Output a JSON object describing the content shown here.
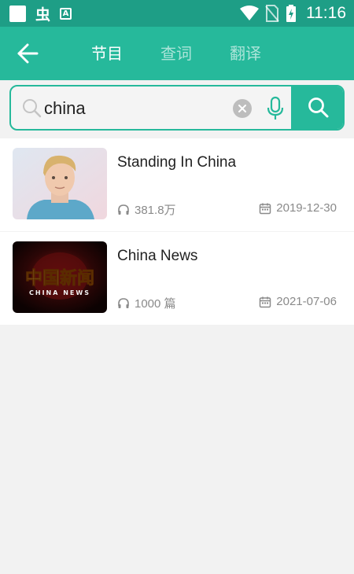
{
  "status_bar": {
    "time": "11:16",
    "left_icons": [
      "square-notification-icon",
      "bug-icon",
      "a-box-icon"
    ],
    "right_icons": [
      "wifi-icon",
      "no-sim-icon",
      "battery-charging-icon"
    ]
  },
  "app_bar": {
    "tabs": [
      {
        "label": "节目",
        "active": true
      },
      {
        "label": "查词",
        "active": false
      },
      {
        "label": "翻译",
        "active": false
      }
    ]
  },
  "search": {
    "value": "china",
    "placeholder": ""
  },
  "results": [
    {
      "title": "Standing In China",
      "listens": "381.8万",
      "date": "2019-12-30",
      "thumb": "portrait-thumbnail"
    },
    {
      "title": "China News",
      "listens": "1000 篇",
      "date": "2021-07-06",
      "thumb": "china-news-logo-thumbnail",
      "thumb_text_main": "中国新闻",
      "thumb_text_sub": "CHINA NEWS"
    }
  ],
  "colors": {
    "status_bar": "#1e9e86",
    "primary": "#26b99b",
    "background": "#f2f2f2"
  }
}
